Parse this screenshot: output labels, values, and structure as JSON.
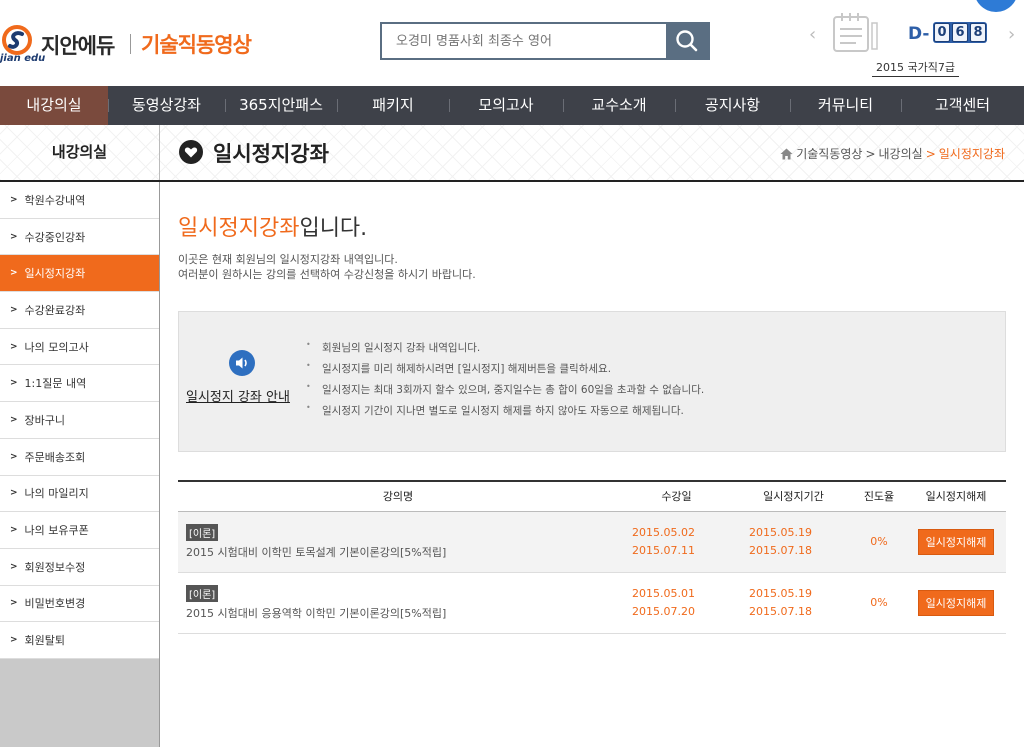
{
  "header": {
    "logo_sub": "jian edu",
    "brand": "지안에듀",
    "site_title": "기술직동영상",
    "search_placeholder": "오경미 명품사회 최종수 영어",
    "dday_label": "D-",
    "dday_digits": [
      "0",
      "6",
      "8"
    ],
    "dday_exam": "2015 국가직7급"
  },
  "nav": {
    "items": [
      {
        "label": "내강의실",
        "active": true
      },
      {
        "label": "동영상강좌"
      },
      {
        "label": "365지안패스"
      },
      {
        "label": "패키지"
      },
      {
        "label": "모의고사"
      },
      {
        "label": "교수소개"
      },
      {
        "label": "공지사항"
      },
      {
        "label": "커뮤니티"
      },
      {
        "label": "고객센터"
      }
    ]
  },
  "strip": {
    "section": "내강의실",
    "page_title": "일시정지강좌",
    "breadcrumb": [
      "기술직동영상",
      "내강의실",
      "일시정지강좌"
    ]
  },
  "sidebar": {
    "items": [
      {
        "label": "학원수강내역"
      },
      {
        "label": "수강중인강좌"
      },
      {
        "label": "일시정지강좌",
        "active": true
      },
      {
        "label": "수강완료강좌"
      },
      {
        "label": "나의 모의고사"
      },
      {
        "label": "1:1질문 내역"
      },
      {
        "label": "장바구니"
      },
      {
        "label": "주문배송조회"
      },
      {
        "label": "나의 마일리지"
      },
      {
        "label": "나의 보유쿠폰"
      },
      {
        "label": "회원정보수정"
      },
      {
        "label": "비밀번호변경"
      },
      {
        "label": "회원탈퇴"
      }
    ]
  },
  "main": {
    "heading_highlight": "일시정지강좌",
    "heading_rest": "입니다.",
    "desc1": "이곳은 현재 회원님의 일시정지강좌 내역입니다.",
    "desc2": "여러분이 원하시는 강의를 선택하여 수강신청을 하시기 바랍니다.",
    "guide_title": "일시정지 강좌 안내",
    "guide_items": [
      "회원님의 일시정지 강좌 내역입니다.",
      "일시정지를 미리 해제하시려면 [일시정지] 해제버튼을 클릭하세요.",
      "일시정지는 최대 3회까지 할수 있으며, 중지일수는 총 합이 60일을 초과할 수 없습니다.",
      "일시정지 기간이 지나면 별도로 일시정지 해제를 하지 않아도 자동으로 해제됩니다."
    ]
  },
  "table": {
    "headers": {
      "name": "강의명",
      "date": "수강일",
      "pause": "일시정지기간",
      "progress": "진도율",
      "action": "일시정지해제"
    },
    "rows": [
      {
        "badge": "[이론]",
        "title": "2015 시험대비 이학민 토목설계 기본이론강의[5%적립]",
        "date_start": "2015.05.02",
        "date_end": "2015.07.11",
        "pause_start": "2015.05.19",
        "pause_end": "2015.07.18",
        "progress": "0%",
        "action": "일시정지해제"
      },
      {
        "badge": "[이론]",
        "title": "2015 시험대비 응용역학 이학민 기본이론강의[5%적립]",
        "date_start": "2015.05.01",
        "date_end": "2015.07.20",
        "pause_start": "2015.05.19",
        "pause_end": "2015.07.18",
        "progress": "0%",
        "action": "일시정지해제"
      }
    ]
  },
  "colors": {
    "accent": "#f06a1c",
    "nav_bg": "#3e4149",
    "nav_active": "#7a4a3d",
    "dday_blue": "#2e5fa8"
  }
}
